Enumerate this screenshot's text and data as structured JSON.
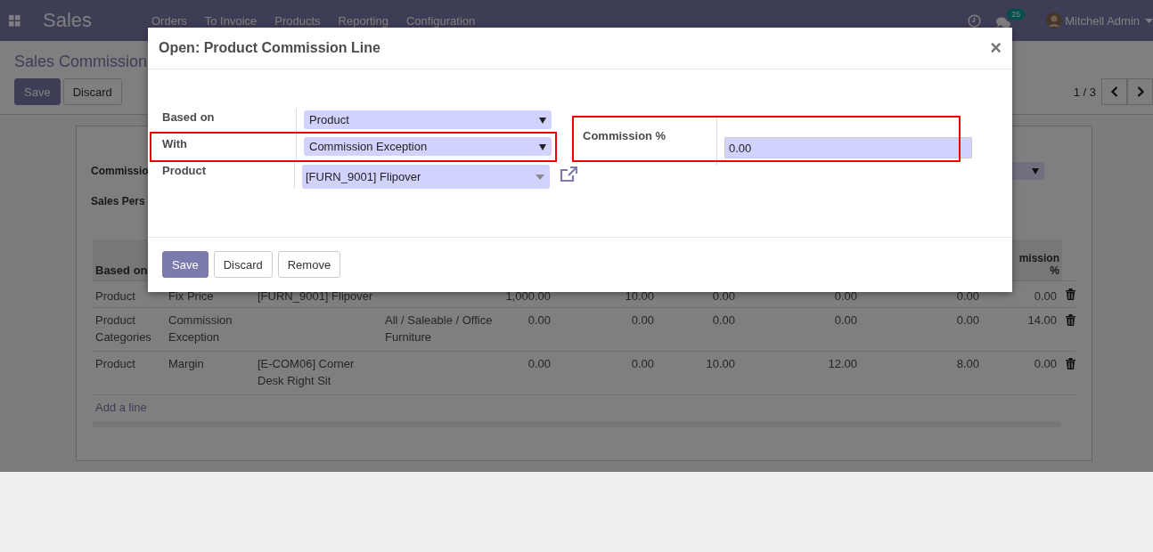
{
  "navbar": {
    "brand": "Sales",
    "menu": [
      "Orders",
      "To Invoice",
      "Products",
      "Reporting",
      "Configuration"
    ],
    "notifications": "25",
    "user": "Mitchell Admin"
  },
  "control_panel": {
    "title": "Sales Commission",
    "buttons": [
      {
        "label": "Save",
        "primary": true
      },
      {
        "label": "Discard",
        "primary": false
      }
    ],
    "pager": "1 / 3"
  },
  "form": {
    "fields": [
      {
        "label": "Commissio",
        "kind": "select"
      },
      {
        "label": "Sales Pers",
        "kind": "plain"
      }
    ]
  },
  "table": {
    "columns": [
      {
        "label": "Based on",
        "numeric": false
      },
      {
        "numeric": false
      },
      {
        "numeric": false
      },
      {
        "numeric": false
      },
      {
        "numeric": true
      },
      {
        "numeric": true
      },
      {
        "numeric": true
      },
      {
        "numeric": true
      },
      {
        "numeric": true
      },
      {
        "label": "mission %",
        "numeric": true
      }
    ],
    "rows": [
      {
        "cells": [
          "Product",
          "Fix Price",
          "[FURN_9001] Flipover",
          "",
          "1,000.00",
          "10.00",
          "0.00",
          "0.00",
          "0.00",
          "0.00"
        ]
      },
      {
        "cells": [
          "Product Categories",
          "Commission Exception",
          "",
          "All / Saleable / Office Furniture",
          "0.00",
          "0.00",
          "0.00",
          "0.00",
          "0.00",
          "14.00"
        ]
      },
      {
        "cells": [
          "Product",
          "Margin",
          "[E-COM06] Corner Desk Right Sit",
          "",
          "0.00",
          "0.00",
          "10.00",
          "12.00",
          "8.00",
          "0.00"
        ]
      }
    ],
    "add_line": "Add a line"
  },
  "modal": {
    "title": "Open: Product Commission Line",
    "close": "×",
    "left_fields": [
      {
        "label": "Based on",
        "value": "Product",
        "kind": "select",
        "highlighted": false
      },
      {
        "label": "With",
        "value": "Commission Exception",
        "kind": "select",
        "highlighted": true
      },
      {
        "label": "Product",
        "value": "[FURN_9001] Flipover",
        "kind": "many2one",
        "highlighted": false
      }
    ],
    "right_fields": [
      {
        "label": "Commission %",
        "value": "0.00",
        "kind": "input",
        "highlighted": true
      }
    ],
    "buttons": [
      {
        "label": "Save",
        "primary": true
      },
      {
        "label": "Discard",
        "primary": false
      },
      {
        "label": "Remove",
        "primary": false
      }
    ]
  }
}
